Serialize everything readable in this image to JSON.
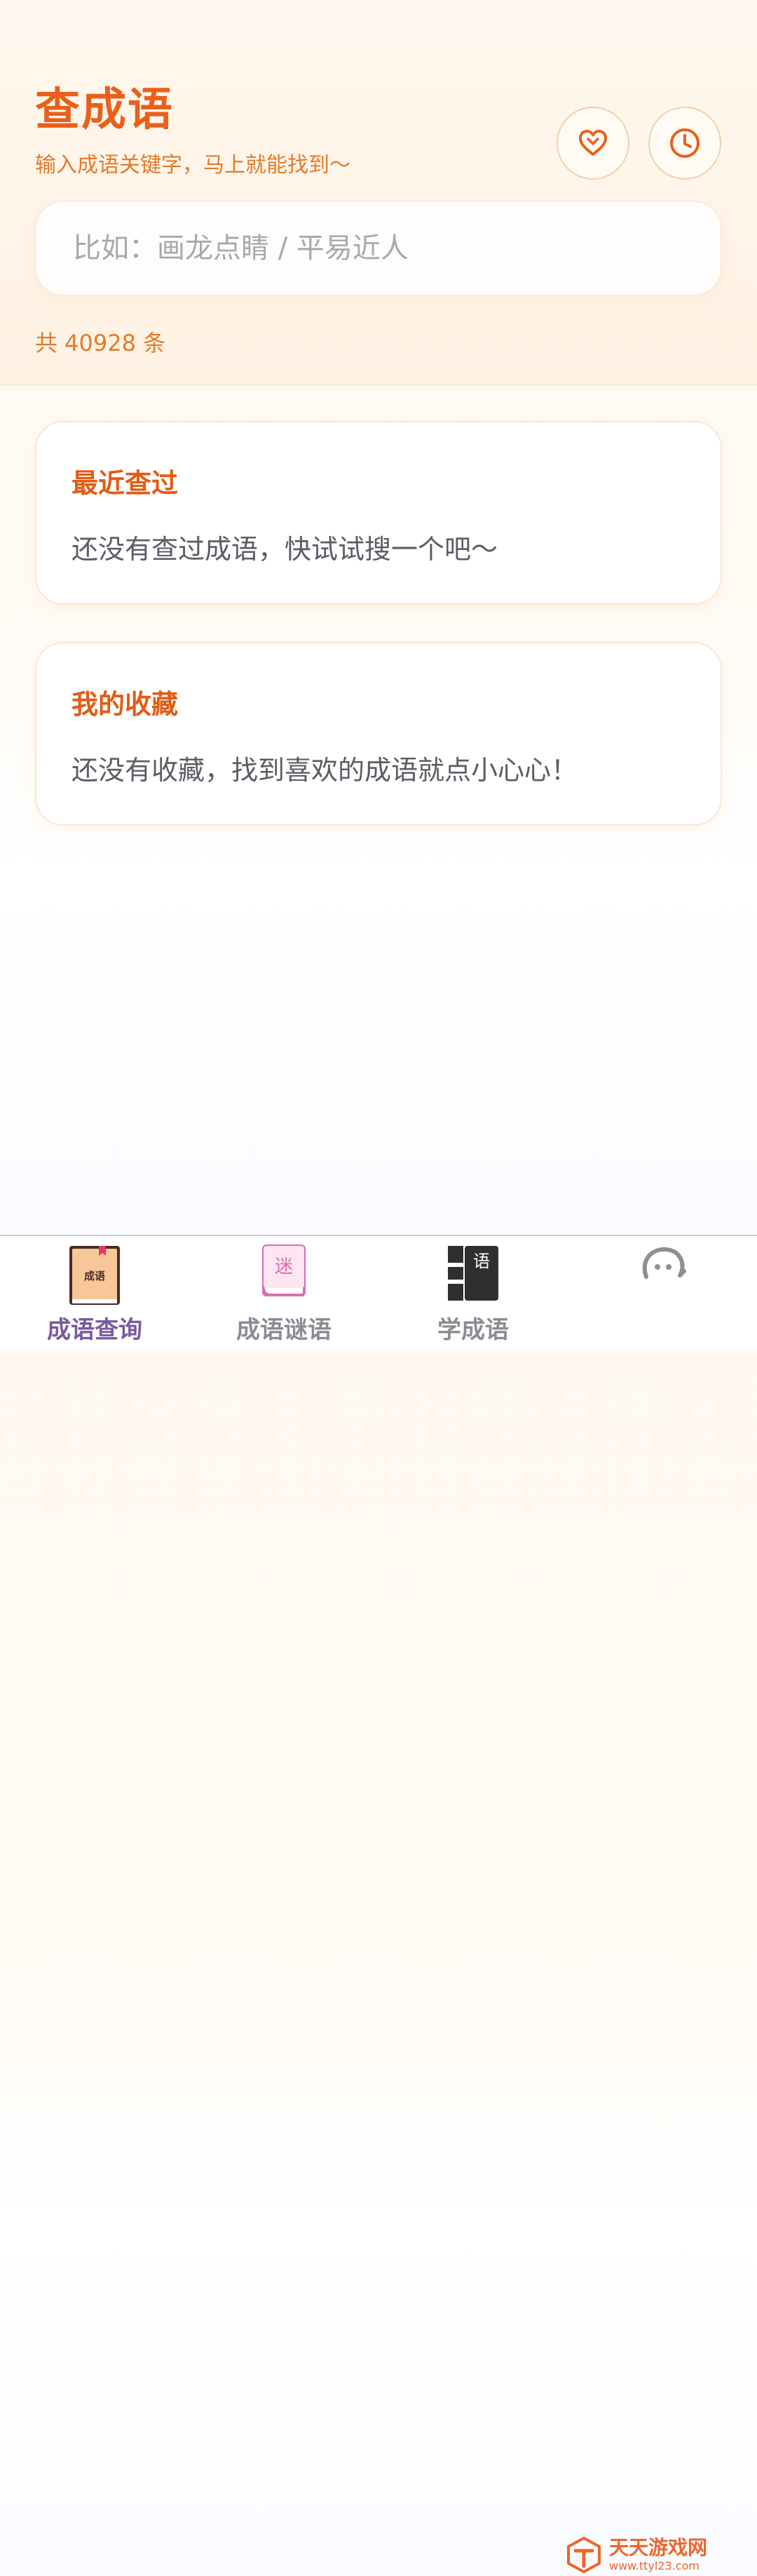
{
  "header": {
    "title": "查成语",
    "subtitle": "输入成语关键字，马上就能找到～",
    "favorite_icon": "heart-icon",
    "history_icon": "clock-icon"
  },
  "search": {
    "placeholder": "比如：画龙点睛 / 平易近人",
    "value": ""
  },
  "count_text": "共 40928 条",
  "recent": {
    "title": "最近查过",
    "empty_text": "还没有查过成语，快试试搜一个吧～"
  },
  "favorites": {
    "title": "我的收藏",
    "empty_text": "还没有收藏，找到喜欢的成语就点小心心！"
  },
  "nav": {
    "items": [
      {
        "label": "成语查询",
        "icon": "book-icon",
        "icon_text": "成语",
        "active": true
      },
      {
        "label": "成语谜语",
        "icon": "riddle-book-icon",
        "icon_text": "迷",
        "active": false
      },
      {
        "label": "学成语",
        "icon": "learn-book-icon",
        "icon_text": "语",
        "active": false
      },
      {
        "label": "",
        "icon": "chat-icon",
        "active": false
      }
    ]
  },
  "watermark": {
    "main": "天天游戏网",
    "sub": "www.ttyl23.com"
  },
  "colors": {
    "accent": "#e9601b",
    "accent_light": "#e47a2a",
    "nav_active": "#7a5a9e",
    "nav_inactive": "#8a8c94"
  }
}
